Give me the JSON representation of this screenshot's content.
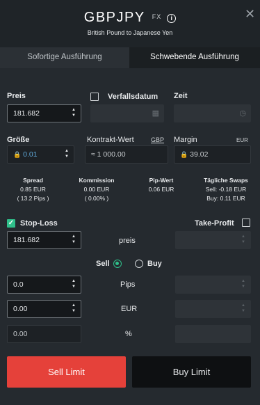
{
  "header": {
    "symbol": "GBPJPY",
    "type": "FX",
    "description": "British Pound to Japanese Yen",
    "info_glyph": "i",
    "close_glyph": "✕"
  },
  "tabs": [
    {
      "label": "Sofortige Ausführung",
      "active": false
    },
    {
      "label": "Schwebende Ausführung",
      "active": true
    }
  ],
  "order": {
    "price_label": "Preis",
    "price_value": "181.682",
    "expiry_label": "Verfallsdatum",
    "expiry_checked": false,
    "time_label": "Zeit",
    "size_label": "Größe",
    "size_value": "0.01",
    "contract_label": "Kontrakt-Wert",
    "contract_currency": "GBP",
    "contract_value": "≈ 1 000.00",
    "margin_label": "Margin",
    "margin_currency": "EUR",
    "margin_value": "39.02"
  },
  "stats": {
    "spread_label": "Spread",
    "spread_value": "0.85 EUR",
    "spread_pips": "( 13.2 Pips )",
    "commission_label": "Kommission",
    "commission_value": "0.00 EUR",
    "commission_pct": "( 0.00% )",
    "pip_label": "Pip-Wert",
    "pip_value": "0.06 EUR",
    "swaps_label": "Tägliche Swaps",
    "swap_sell": "Sell: -0.18 EUR",
    "swap_buy": "Buy: 0.11 EUR"
  },
  "stop_loss": {
    "label": "Stop-Loss",
    "checked": true,
    "take_profit_label": "Take-Profit",
    "take_profit_checked": false,
    "price_value": "181.682",
    "price_label": "preis",
    "side_sell": "Sell",
    "side_buy": "Buy",
    "selected_side": "Sell",
    "pips_value": "0.0",
    "pips_label": "Pips",
    "eur_value": "0.00",
    "eur_label": "EUR",
    "pct_value": "0.00",
    "pct_label": "%"
  },
  "buttons": {
    "sell_limit": "Sell Limit",
    "buy_limit": "Buy Limit"
  },
  "colors": {
    "sell": "#e5413a",
    "accent": "#2fbf8a",
    "background": "#252a2f"
  }
}
